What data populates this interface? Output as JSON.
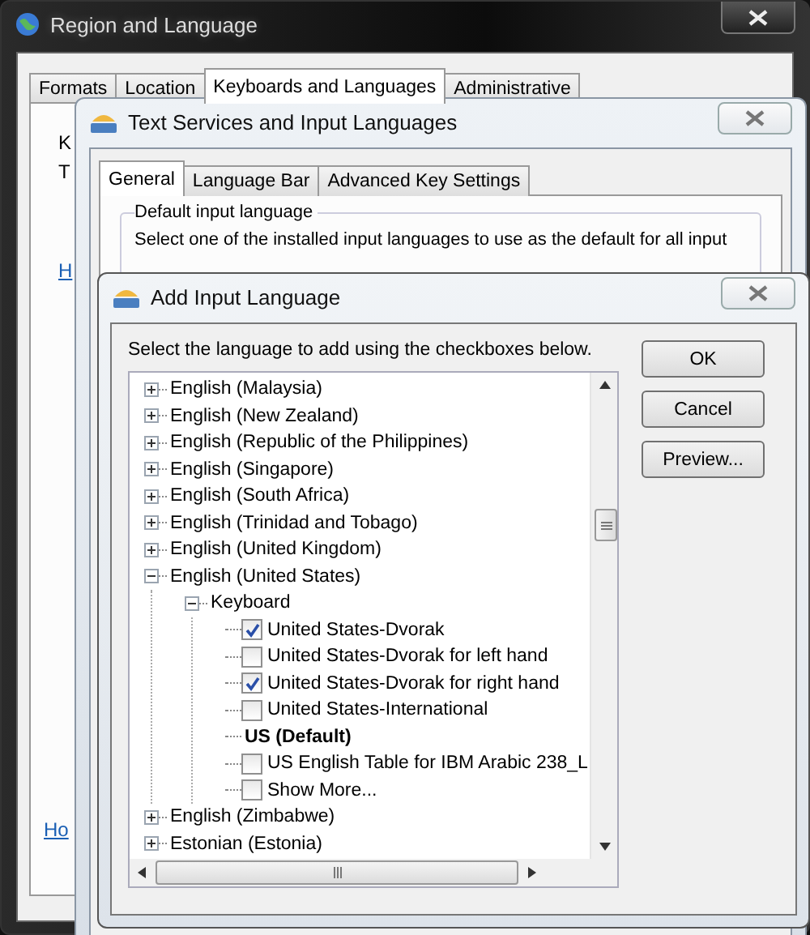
{
  "region_window": {
    "title": "Region and Language",
    "tabs": [
      {
        "label": "Formats",
        "selected": false
      },
      {
        "label": "Location",
        "selected": false
      },
      {
        "label": "Keyboards and Languages",
        "selected": true
      },
      {
        "label": "Administrative",
        "selected": false
      }
    ],
    "fragments": [
      {
        "kind": "text",
        "text": "K"
      },
      {
        "kind": "text",
        "text": "T"
      },
      {
        "kind": "link",
        "text": "H"
      },
      {
        "kind": "link",
        "text": "Ho"
      }
    ]
  },
  "text_services_window": {
    "title": "Text Services and Input Languages",
    "tabs": [
      {
        "label": "General",
        "selected": true
      },
      {
        "label": "Language Bar",
        "selected": false
      },
      {
        "label": "Advanced Key Settings",
        "selected": false
      }
    ],
    "group_title": "Default input language",
    "description": "Select one of the installed input languages to use as the default for all input"
  },
  "add_window": {
    "title": "Add Input Language",
    "instruction": "Select the language to add using the checkboxes below.",
    "buttons": [
      "OK",
      "Cancel",
      "Preview..."
    ],
    "tree": [
      {
        "label": "English (Malaysia)",
        "expanded": false
      },
      {
        "label": "English (New Zealand)",
        "expanded": false
      },
      {
        "label": "English (Republic of the Philippines)",
        "expanded": false
      },
      {
        "label": "English (Singapore)",
        "expanded": false
      },
      {
        "label": "English (South Africa)",
        "expanded": false
      },
      {
        "label": "English (Trinidad and Tobago)",
        "expanded": false
      },
      {
        "label": "English (United Kingdom)",
        "expanded": false
      },
      {
        "label": "English (United States)",
        "expanded": true,
        "children": [
          {
            "label": "Keyboard",
            "expanded": true,
            "children": [
              {
                "kind": "checkbox",
                "label": "United States-Dvorak",
                "checked": true
              },
              {
                "kind": "checkbox",
                "label": "United States-Dvorak for left hand",
                "checked": false
              },
              {
                "kind": "checkbox",
                "label": "United States-Dvorak for right hand",
                "checked": true
              },
              {
                "kind": "checkbox",
                "label": "United States-International",
                "checked": false
              },
              {
                "kind": "default",
                "label": "US (Default)"
              },
              {
                "kind": "checkbox",
                "label": "US English Table for IBM Arabic 238_L",
                "checked": false
              },
              {
                "kind": "checkbox",
                "label": "Show More...",
                "checked": false
              }
            ]
          }
        ]
      },
      {
        "label": "English (Zimbabwe)",
        "expanded": false
      },
      {
        "label": "Estonian (Estonia)",
        "expanded": false
      }
    ]
  }
}
